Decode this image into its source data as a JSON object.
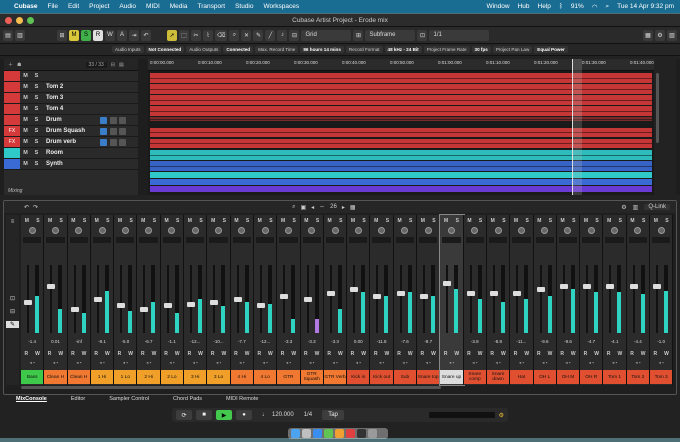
{
  "menubar": {
    "app": "Cubase",
    "items": [
      "File",
      "Edit",
      "Project",
      "Audio",
      "MIDI",
      "Media",
      "Transport",
      "Studio",
      "Workspaces"
    ],
    "right_items": [
      "Window",
      "Hub",
      "Help"
    ],
    "battery": "91%",
    "datetime": "Tue 14 Apr  9:32 pm"
  },
  "window": {
    "title": "Cubase Artist Project - Erode mix"
  },
  "toolbar": {
    "modes": [
      "M",
      "S",
      "R",
      "W",
      "A"
    ],
    "snap_type": "Grid",
    "grid_type": "Subframe",
    "quantize": "1/1"
  },
  "status": [
    {
      "label": "Audio Inputs",
      "value": "Not Connected"
    },
    {
      "label": "Audio Outputs",
      "value": "Connected"
    },
    {
      "label": "Max. Record Time",
      "value": "86 hours 14 mins"
    },
    {
      "label": "Record Format",
      "value": "48 kHz - 24 Bit"
    },
    {
      "label": "Project Frame Rate",
      "value": "30 fps"
    },
    {
      "label": "Project Pan Law",
      "value": "Equal Power"
    }
  ],
  "tracklist": {
    "count": "33 / 33",
    "tracks": [
      {
        "num": "",
        "name": "",
        "color": "#d43a3a"
      },
      {
        "num": "",
        "name": "Tom 2",
        "color": "#d43a3a"
      },
      {
        "num": "",
        "name": "Tom 3",
        "color": "#d43a3a"
      },
      {
        "num": "",
        "name": "Tom 4",
        "color": "#d43a3a"
      },
      {
        "num": "",
        "name": "Drum",
        "color": "#d43a3a"
      },
      {
        "num": "FX",
        "name": "Drum Squash",
        "color": "#d43a3a"
      },
      {
        "num": "FX",
        "name": "Drum verb",
        "color": "#d43a3a"
      },
      {
        "num": "",
        "name": "Room",
        "color": "#2fc9c9"
      },
      {
        "num": "",
        "name": "Synth",
        "color": "#3a6ad4"
      }
    ],
    "footer": "Mixing"
  },
  "ruler_ticks": [
    "0:00:00.000",
    "0:00:10.000",
    "0:00:20.000",
    "0:00:30.000",
    "0:00:40.000",
    "0:00:50.000",
    "0:01:00.000",
    "0:01:10.000",
    "0:01:20.000",
    "0:01:30.000",
    "0:01:40.000"
  ],
  "mixer": {
    "zoom": "26",
    "link_label": "Q-Link",
    "channels": [
      {
        "name": "Bass",
        "value": "-1.4",
        "level": 0.55,
        "fader": 0.45,
        "color": "#3fc94a"
      },
      {
        "name": "Clean H",
        "value": "0.01",
        "level": 0.35,
        "fader": 0.7,
        "color": "#f07830"
      },
      {
        "name": "Clean H",
        "value": "-inf",
        "level": 0.3,
        "fader": 0.35,
        "color": "#f07830"
      },
      {
        "name": "1 Hi",
        "value": "-9.1",
        "level": 0.62,
        "fader": 0.5,
        "color": "#f0a028"
      },
      {
        "name": "1 Lo",
        "value": "-5.0",
        "level": 0.32,
        "fader": 0.4,
        "color": "#f0a028"
      },
      {
        "name": "2 Hi",
        "value": "-6.7",
        "level": 0.45,
        "fader": 0.35,
        "color": "#f0a028"
      },
      {
        "name": "2 Lo",
        "value": "-1.1",
        "level": 0.3,
        "fader": 0.4,
        "color": "#f0a028"
      },
      {
        "name": "3 Hi",
        "value": "-12...",
        "level": 0.5,
        "fader": 0.42,
        "color": "#f0a028"
      },
      {
        "name": "3 Lo",
        "value": "-10...",
        "level": 0.4,
        "fader": 0.45,
        "color": "#f0a028"
      },
      {
        "name": "4 Hi",
        "value": "-7.7",
        "level": 0.45,
        "fader": 0.5,
        "color": "#f07830"
      },
      {
        "name": "4 Lo",
        "value": "-12...",
        "level": 0.42,
        "fader": 0.4,
        "color": "#f07830"
      },
      {
        "name": "GTR",
        "value": "-3.3",
        "level": 0.2,
        "fader": 0.55,
        "color": "#f07830"
      },
      {
        "name": "GTR Squash",
        "value": "-3.3",
        "level": 0.2,
        "fader": 0.5,
        "color": "#f07830"
      },
      {
        "name": "GTR Verb",
        "value": "-3.3",
        "level": 0.35,
        "fader": 0.6,
        "color": "#f07830"
      },
      {
        "name": "Kick in",
        "value": "0.00",
        "level": 0.6,
        "fader": 0.65,
        "color": "#e05030"
      },
      {
        "name": "Kick out",
        "value": "-11.8",
        "level": 0.55,
        "fader": 0.55,
        "color": "#e05030"
      },
      {
        "name": "Sub",
        "value": "-7.6",
        "level": 0.6,
        "fader": 0.6,
        "color": "#e05030"
      },
      {
        "name": "Snare top",
        "value": "-9.7",
        "level": 0.55,
        "fader": 0.55,
        "color": "#e05030"
      },
      {
        "name": "Snare up",
        "value": "",
        "level": 0.65,
        "fader": 0.75,
        "color": "#ddd"
      },
      {
        "name": "Snare comp",
        "value": "-3.8",
        "level": 0.5,
        "fader": 0.6,
        "color": "#e05030"
      },
      {
        "name": "Snare down",
        "value": "-8.8",
        "level": 0.45,
        "fader": 0.6,
        "color": "#e05030"
      },
      {
        "name": "Hat",
        "value": "-11...",
        "level": 0.5,
        "fader": 0.6,
        "color": "#e05030"
      },
      {
        "name": "OH L",
        "value": "-9.6",
        "level": 0.55,
        "fader": 0.65,
        "color": "#e05030"
      },
      {
        "name": "OH M",
        "value": "-9.6",
        "level": 0.65,
        "fader": 0.7,
        "color": "#e05030"
      },
      {
        "name": "OH R",
        "value": "-4.7",
        "level": 0.6,
        "fader": 0.7,
        "color": "#e05030"
      },
      {
        "name": "Tom 1",
        "value": "-4.1",
        "level": 0.6,
        "fader": 0.7,
        "color": "#e05030"
      },
      {
        "name": "Tom 2",
        "value": "-4.4",
        "level": 0.58,
        "fader": 0.7,
        "color": "#e05030"
      },
      {
        "name": "Tom 3",
        "value": "-1.0",
        "level": 0.62,
        "fader": 0.7,
        "color": "#e05030"
      }
    ]
  },
  "tabs": [
    "MixConsole",
    "Editor",
    "Sampler Control",
    "Chord Pads",
    "MIDI Remote"
  ],
  "transport": {
    "tempo": "120.000",
    "signature": "1/4",
    "tap": "Tap"
  },
  "colors": {
    "menubar": "#1a6d92",
    "play": "#43c94d",
    "wave_red": "#d43a3a",
    "wave_cyan": "#2fc9c9"
  }
}
